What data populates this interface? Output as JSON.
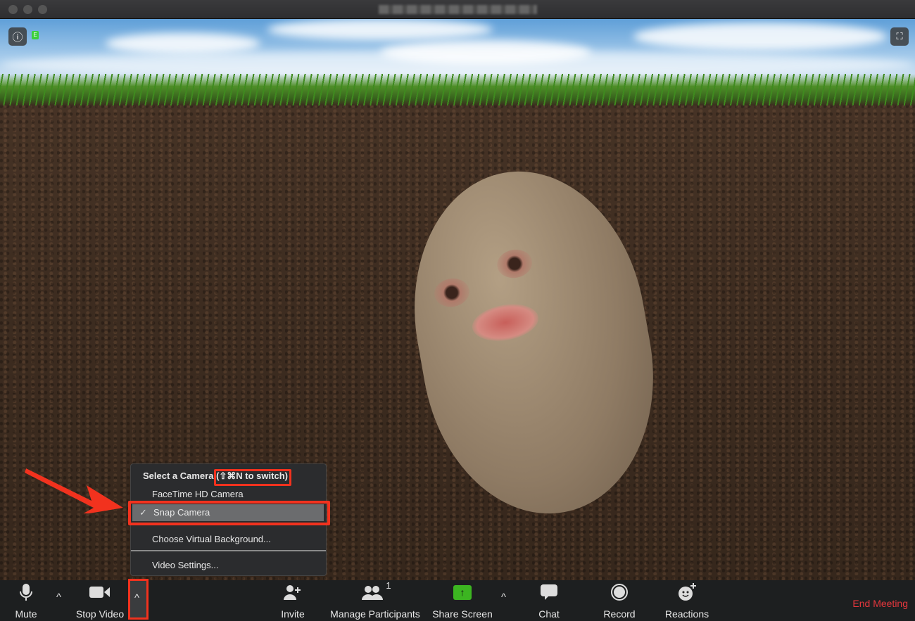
{
  "window": {
    "title": "Zoom Meeting"
  },
  "video": {
    "info_icon": "info-icon",
    "fullscreen_icon": "fullscreen-icon",
    "encryption_icon": "lock-icon"
  },
  "camera_menu": {
    "header": "Select a Camera (",
    "shortcut": "⇧⌘N to switch)",
    "items": [
      {
        "label": "FaceTime HD Camera",
        "checked": false
      },
      {
        "label": "Snap Camera",
        "checked": true
      },
      {
        "label": "Choose Virtual Background..."
      },
      {
        "label": "Video Settings..."
      }
    ],
    "check": "✓"
  },
  "toolbar": {
    "mute": "Mute",
    "stop_video": "Stop Video",
    "invite": "Invite",
    "manage_participants": "Manage Participants",
    "participant_count": "1",
    "share_screen": "Share Screen",
    "chat": "Chat",
    "record": "Record",
    "reactions": "Reactions",
    "end_meeting": "End Meeting",
    "caret": "^"
  },
  "colors": {
    "highlight": "#f2321e",
    "share_green": "#3cb521",
    "end_red": "#e5373d"
  }
}
